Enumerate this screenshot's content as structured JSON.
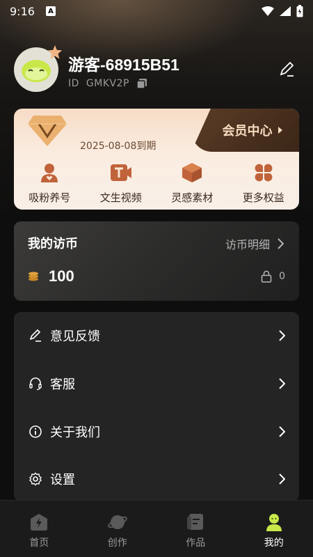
{
  "status_bar": {
    "time": "9:16",
    "notification_icon": "A"
  },
  "profile": {
    "username": "游客-68915B51",
    "id_label": "ID",
    "id_value": "GMKV2P"
  },
  "vip": {
    "expiry": "2025-08-08到期",
    "center_label": "会员中心",
    "perks": [
      {
        "label": "吸粉养号",
        "icon": "user-heart-icon"
      },
      {
        "label": "文生视频",
        "icon": "text-video-icon"
      },
      {
        "label": "灵感素材",
        "icon": "box-icon"
      },
      {
        "label": "更多权益",
        "icon": "clover-icon"
      }
    ]
  },
  "coins": {
    "title": "我的访币",
    "detail_label": "访币明细",
    "amount": "100",
    "locked": "0"
  },
  "menu": [
    {
      "label": "意见反馈",
      "icon": "feedback-pen-icon"
    },
    {
      "label": "客服",
      "icon": "headset-icon"
    },
    {
      "label": "关于我们",
      "icon": "info-icon"
    },
    {
      "label": "设置",
      "icon": "gear-icon"
    }
  ],
  "tabs": [
    {
      "label": "首页",
      "icon": "home-icon",
      "active": false
    },
    {
      "label": "创作",
      "icon": "planet-icon",
      "active": false
    },
    {
      "label": "作品",
      "icon": "works-icon",
      "active": false
    },
    {
      "label": "我的",
      "icon": "profile-icon",
      "active": true
    }
  ],
  "colors": {
    "accent_green": "#c8e84a",
    "vip_brown": "#4a2f1d",
    "card_dark": "#242424"
  }
}
